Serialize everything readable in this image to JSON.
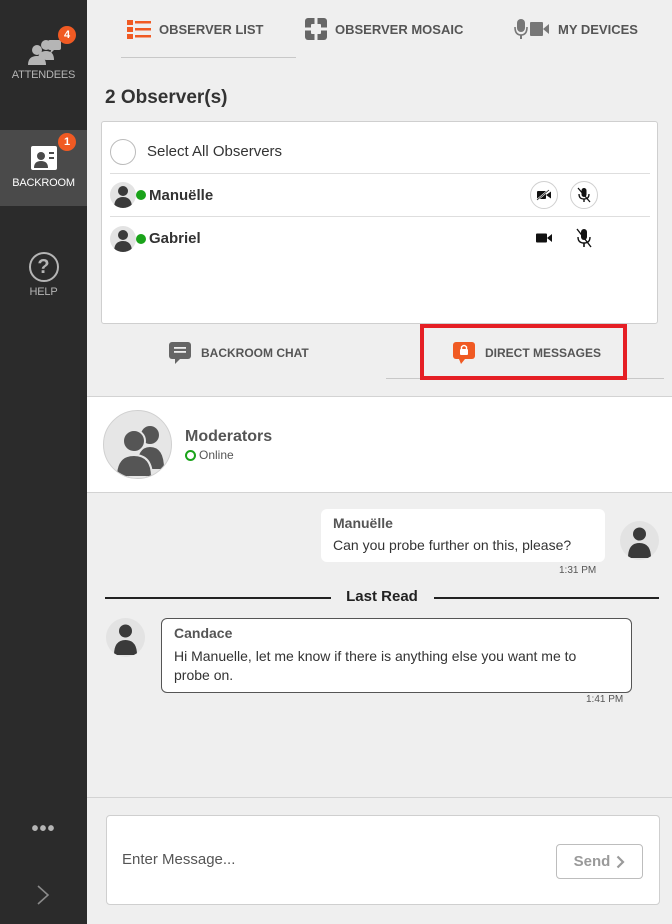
{
  "sidebar": {
    "items": [
      {
        "label": "ATTENDEES",
        "badge": "4",
        "icon": "attendees-icon"
      },
      {
        "label": "BACKROOM",
        "badge": "1",
        "icon": "backroom-icon",
        "active": true
      },
      {
        "label": "HELP",
        "icon": "help-icon",
        "glyph": "?"
      }
    ],
    "more": "•••",
    "expand_icon": "chevron-right-icon"
  },
  "top_tabs": [
    {
      "label": "OBSERVER LIST",
      "icon": "list-icon"
    },
    {
      "label": "OBSERVER MOSAIC",
      "icon": "mosaic-icon"
    },
    {
      "label": "MY DEVICES",
      "icon": "devices-icon"
    }
  ],
  "observers": {
    "title": "2 Observer(s)",
    "select_all": "Select All Observers",
    "list": [
      {
        "name": "Manuëlle",
        "status": "online",
        "camera": "off",
        "mic": "off"
      },
      {
        "name": "Gabriel",
        "status": "online",
        "camera": "on",
        "mic": "off"
      }
    ]
  },
  "chat_tabs": [
    {
      "label": "BACKROOM CHAT",
      "icon": "chat-icon"
    },
    {
      "label": "DIRECT MESSAGES",
      "icon": "lock-chat-icon",
      "active": true
    }
  ],
  "conversation": {
    "name": "Moderators",
    "status": "Online"
  },
  "messages": [
    {
      "author": "Manuëlle",
      "text": "Can you probe further on this, please?",
      "time": "1:31 PM",
      "side": "right"
    },
    {
      "author": "Candace",
      "lines": [
        "Hi Manuelle, let me know if there is anything else you want me to",
        "probe on."
      ],
      "time": "1:41 PM",
      "side": "left"
    }
  ],
  "last_read": "Last Read",
  "composer": {
    "placeholder": "Enter Message...",
    "send_label": "Send"
  },
  "colors": {
    "sidebar_bg": "#2b2b2b",
    "accent_orange": "#f05a23",
    "online_green": "#1aa31a",
    "highlight_red": "#e51f25"
  }
}
